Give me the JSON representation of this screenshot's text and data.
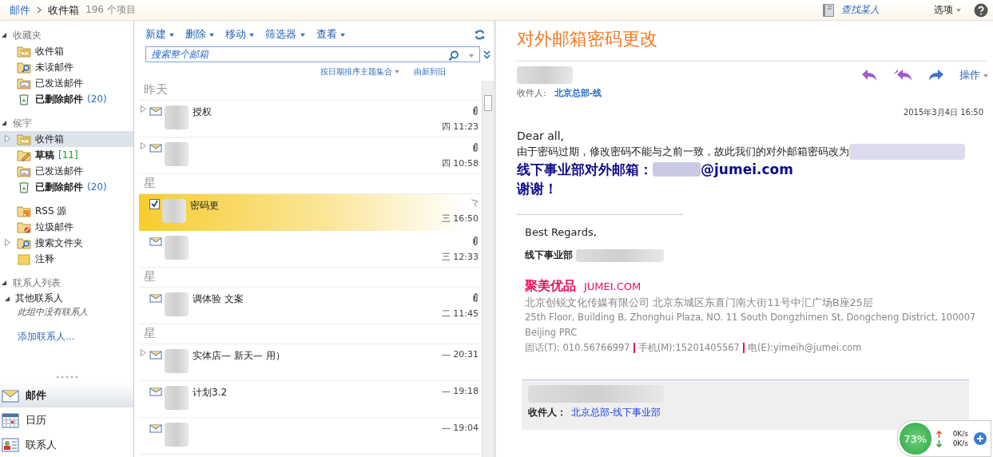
{
  "breadcrumb": {
    "root": "邮件",
    "current": "收件箱",
    "count": "196 个项目"
  },
  "top_links": {
    "find": "查找某人",
    "options": "选项"
  },
  "nav_groups": [
    {
      "title": "收藏夹",
      "expanded": true,
      "items": [
        {
          "label": "收件箱",
          "kind": "inbox",
          "unread": false,
          "selected": false,
          "expandable": false
        },
        {
          "label": "未读邮件",
          "kind": "search",
          "unread": false,
          "selected": false,
          "expandable": false
        },
        {
          "label": "已发送邮件",
          "kind": "sent",
          "unread": false,
          "selected": false,
          "expandable": false
        },
        {
          "label": "已删除邮件",
          "kind": "trash",
          "unread": true,
          "count": "(20)",
          "selected": false,
          "expandable": false
        }
      ]
    },
    {
      "title": "侯宇",
      "expanded": true,
      "items": [
        {
          "label": "收件箱",
          "kind": "inbox",
          "unread": false,
          "selected": true,
          "expandable": true
        },
        {
          "label": "草稿",
          "kind": "draft",
          "unread": true,
          "count": "[11]",
          "selected": false,
          "expandable": false
        },
        {
          "label": "已发送邮件",
          "kind": "sent",
          "unread": false,
          "selected": false,
          "expandable": false
        },
        {
          "label": "已删除邮件",
          "kind": "trash",
          "unread": true,
          "count": "(20)",
          "selected": false,
          "expandable": false
        }
      ]
    },
    {
      "items": [
        {
          "label": "RSS 源",
          "kind": "rss",
          "unread": false,
          "selected": false,
          "expandable": false
        },
        {
          "label": "垃圾邮件",
          "kind": "junk",
          "unread": false,
          "selected": false,
          "expandable": false
        },
        {
          "label": "搜索文件夹",
          "kind": "search",
          "unread": false,
          "selected": false,
          "expandable": true
        },
        {
          "label": "注释",
          "kind": "note",
          "unread": false,
          "selected": false,
          "expandable": false
        }
      ]
    }
  ],
  "contacts": {
    "title": "联系人列表",
    "group": "其他联系人",
    "empty": "此组中没有联系人",
    "add": "添加联系人..."
  },
  "modules": [
    {
      "label": "邮件",
      "kind": "mail",
      "selected": true
    },
    {
      "label": "日历",
      "kind": "calendar",
      "selected": false
    },
    {
      "label": "联系人",
      "kind": "contacts",
      "selected": false
    }
  ],
  "toolbar": [
    "新建",
    "删除",
    "移动",
    "筛选器",
    "查看"
  ],
  "search": {
    "placeholder": "搜索整个邮箱"
  },
  "sort": {
    "by": "按日期排序主题集合",
    "order": "由新到旧"
  },
  "messages": [
    {
      "kind": "header",
      "label": "昨天"
    },
    {
      "kind": "mail",
      "subject": "授权",
      "time": "四 11:23",
      "attachment": true,
      "selected": false,
      "thread": true
    },
    {
      "kind": "mail",
      "time": "四 10:58",
      "attachment": true,
      "selected": false,
      "thread": true
    },
    {
      "kind": "header",
      "label": "星"
    },
    {
      "kind": "mail",
      "subject": "密码更",
      "time": "三 16:50",
      "attachment": false,
      "selected": true,
      "thread": false
    },
    {
      "kind": "mail",
      "time": "三 12:33",
      "attachment": true,
      "selected": false,
      "thread": false
    },
    {
      "kind": "header",
      "label": "星"
    },
    {
      "kind": "mail",
      "subject": "调体验  文案",
      "time": "二 11:45",
      "attachment": true,
      "selected": false,
      "thread": false
    },
    {
      "kind": "header",
      "label": "星"
    },
    {
      "kind": "mail",
      "subject": "实体店—  新天—  用）",
      "time": "— 20:31",
      "attachment": false,
      "selected": false,
      "thread": true
    },
    {
      "kind": "mail",
      "subject": "计划3.2",
      "time": "— 19:18",
      "attachment": false,
      "selected": false,
      "thread": false
    },
    {
      "kind": "mail",
      "time": "— 19:04",
      "attachment": false,
      "selected": false,
      "thread": false
    }
  ],
  "reading": {
    "title": "对外邮箱密码更改",
    "to_label": "收件人:",
    "to": "北京总部-线",
    "action": "操作",
    "date": "2015年3月4日 16:50",
    "greeting": "Dear all,",
    "line1": "由于密码过期，修改密码不能与之前一致，故此我们的对外邮箱密码改为",
    "mailbox_label": "线下事业部对外邮箱：",
    "mailbox_domain": "@jumei.com",
    "thanks": "谢谢！",
    "regards": "Best Regards,",
    "dept": "线下事业部",
    "brand": "聚美优品",
    "brand_en": "JUMEI.COM",
    "company": "北京创锐文化传媒有限公司  北京东城区东直门南大街11号中汇广场B座25层",
    "address": "25th Floor, Building B, Zhonghui Plaza, NO. 11 South Dongzhimen St, Dongcheng District, 100007 Beijing PRC",
    "contact": [
      "固话(T): 010.56766997",
      "手机(M):15201405567",
      "电(E):yimeih@jumei.com"
    ],
    "quote_to_label": "收件人：",
    "quote_to": "北京总部-线下事业部"
  },
  "net_widget": {
    "percent": "73%",
    "up": "0K/s",
    "down": "0K/s"
  }
}
